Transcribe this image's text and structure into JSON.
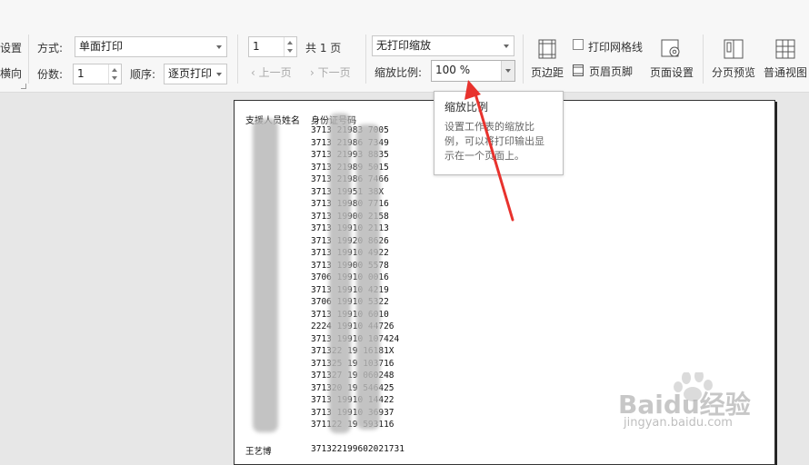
{
  "toolbar": {
    "cut_left_top": "设置",
    "cut_left_bottom": "横向",
    "mode_label": "方式:",
    "mode_value": "单面打印",
    "copies_label": "份数:",
    "copies_value": "1",
    "order_label": "顺序:",
    "order_value": "逐页打印",
    "page_value": "1",
    "page_total": "共 1 页",
    "prev_page": "上一页",
    "next_page": "下一页",
    "scale_mode_value": "无打印缩放",
    "scale_label": "缩放比例:",
    "scale_value": "100 %",
    "print_grid_label": "打印网格线",
    "header_footer_label": "页眉页脚",
    "margins_label": "页边距",
    "page_setup_label": "页面设置",
    "page_break_preview_label": "分页预览",
    "normal_view_label": "普通视图"
  },
  "tooltip": {
    "title": "缩放比例",
    "desc_1": "设置工作表的缩放比",
    "desc_2": "例，可以将打印输出显",
    "desc_3": "示在一个页面上。"
  },
  "sheet": {
    "header_name": "支援人员姓名",
    "header_id": "身份证号码",
    "ids": [
      "3713  21983  7005",
      "3713  21986  7349",
      "3713  21993  8835",
      "3713  21989  5015",
      "3713  21986  7466",
      "3713  19951  38X",
      "3713  19980  7716",
      "3713  19900  2158",
      "3713  19910  2113",
      "3713  19920  8626",
      "3713  19910  4922",
      "3713  19900  5578",
      "3706  19910  0016",
      "3713  19910  4219",
      "3706  19910  5322",
      "3713  19910  6010",
      "2224  19910  44726",
      "3713  19910  107424",
      "371322  19  16181X",
      "371325  19  103716",
      "371327  19  060248",
      "371320  19  546425",
      "3713  19910  14422",
      "3713  19910  36937",
      "371122  19  593116"
    ],
    "bottom_name": "王艺博",
    "bottom_id": "371322199602021731"
  },
  "watermark": {
    "brand": "Baidu经验",
    "url": "jingyan.baidu.com"
  },
  "colors": {
    "arrow": "#e8322d",
    "toolbar_bg": "#f7f7f7",
    "workspace_bg": "#e7e7e7"
  }
}
